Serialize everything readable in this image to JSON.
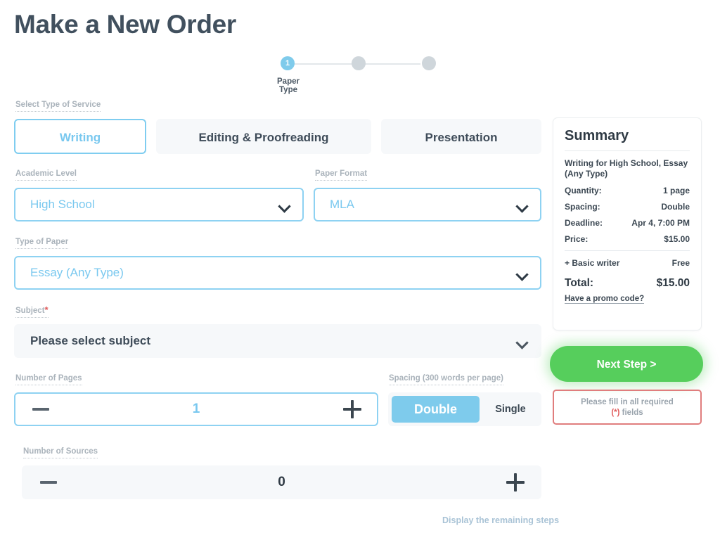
{
  "page": {
    "title": "Make a New Order"
  },
  "stepper": {
    "current_step": "1",
    "current_label": "Paper Type",
    "total_steps": 3
  },
  "service": {
    "label": "Select Type of Service",
    "options": [
      "Writing",
      "Editing & Proofreading",
      "Presentation"
    ],
    "selected": "Writing"
  },
  "fields": {
    "academic_level": {
      "label": "Academic Level",
      "value": "High School"
    },
    "paper_format": {
      "label": "Paper Format",
      "value": "MLA"
    },
    "type_of_paper": {
      "label": "Type of Paper",
      "value": "Essay (Any Type)"
    },
    "subject": {
      "label": "Subject",
      "required_mark": "*",
      "value": "Please select subject"
    },
    "number_of_pages": {
      "label": "Number of Pages",
      "value": "1",
      "minus": "minus-icon",
      "plus": "plus-icon"
    },
    "number_of_sources": {
      "label": "Number of Sources",
      "value": "0",
      "minus": "minus-icon",
      "plus": "plus-icon"
    },
    "spacing": {
      "label": "Spacing (300 words per page)",
      "options": [
        "Double",
        "Single"
      ],
      "selected": "Double"
    }
  },
  "summary": {
    "title": "Summary",
    "description": "Writing for High School, Essay (Any Type)",
    "rows": [
      {
        "label": "Quantity:",
        "value": "1 page"
      },
      {
        "label": "Spacing:",
        "value": "Double"
      },
      {
        "label": "Deadline:",
        "value": "Apr 4, 7:00 PM"
      },
      {
        "label": "Price:",
        "value": "$15.00"
      }
    ],
    "addon": {
      "label": "+ Basic writer",
      "value": "Free"
    },
    "total": {
      "label": "Total:",
      "value": "$15.00"
    },
    "promo_link": "Have a promo code?"
  },
  "actions": {
    "next_step": "Next Step >",
    "warning_line1": "Please fill in all required",
    "warning_star": "(*)",
    "warning_line2": " fields",
    "remaining_steps": "Display the remaining steps"
  },
  "colors": {
    "accent_blue": "#7fcdf0",
    "green": "#56ce5c",
    "red": "#e05a5a",
    "text_dark": "#3b4752",
    "label_grey": "#aab3bb"
  }
}
